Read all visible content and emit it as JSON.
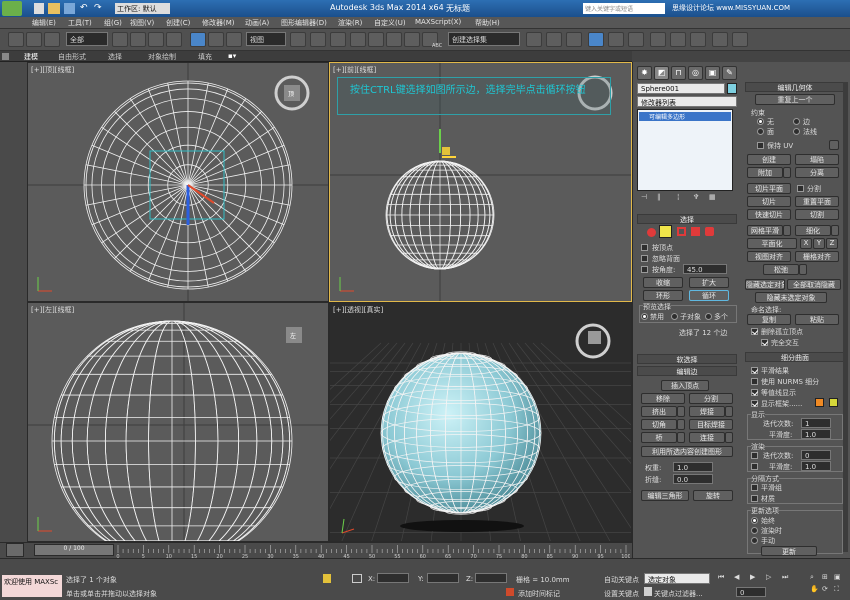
{
  "titlebar": {
    "workspace": "工作区: 默认",
    "app_title": "Autodesk 3ds Max  2014 x64",
    "doc_title": "无标题",
    "search_placeholder": "键入关键字或短语",
    "watermark": "思缘设计论坛 www.MISSYUAN.COM"
  },
  "menu": [
    "编辑(E)",
    "工具(T)",
    "组(G)",
    "视图(V)",
    "创建(C)",
    "修改器(M)",
    "动画(A)",
    "图形编辑器(D)",
    "渲染(R)",
    "自定义(U)",
    "MAXScript(X)",
    "帮助(H)"
  ],
  "toolbar": {
    "selection_filter": "全部",
    "ref_coord": "视图",
    "named_selection": "创建选择集",
    "abc_label": "ABC"
  },
  "ribbon": [
    "建模",
    "自由形式",
    "选择",
    "对象绘制",
    "填充"
  ],
  "viewports": {
    "top_left_label": "[+][顶][线框]",
    "top_right_label": "[+][前][线框]",
    "bottom_left_label": "[+][左][线框]",
    "bottom_right_label": "[+][透视][真实]",
    "cube_top": "顶",
    "cube_left": "左",
    "tip": "按住CTRL键选择如图所示边，选择完毕点击循环按钮"
  },
  "panel": {
    "object_name": "Sphere001",
    "modifier_list": "修改器列表",
    "stack_item": "可编辑多边形",
    "selection": {
      "title": "选择",
      "by_vertex": "按顶点",
      "ignore_backfacing": "忽略背面",
      "by_angle": "按角度:",
      "angle_value": "45.0",
      "shrink": "收缩",
      "grow": "扩大",
      "ring": "环形",
      "loop": "循环",
      "preview_title": "预览选择",
      "disable": "禁用",
      "subobject": "子对象",
      "multi": "多个",
      "status": "选择了 12 个边"
    },
    "soft_selection": "软选择",
    "edit_edges": {
      "title": "编辑边",
      "insert_vertex": "插入顶点",
      "remove": "移除",
      "split": "分割",
      "extrude": "挤出",
      "weld": "焊接",
      "chamfer": "切角",
      "target_weld": "目标焊接",
      "bridge": "桥",
      "connect": "连接",
      "create_shape": "利用所选内容创建图形",
      "weight_label": "权重:",
      "weight_value": "1.0",
      "crease_label": "折缝:",
      "crease_value": "0.0",
      "edit_tri": "编辑三角形",
      "turn": "旋转"
    },
    "edit_geometry": {
      "title": "编辑几何体",
      "repeat_last": "重复上一个",
      "constraints": "约束",
      "none": "无",
      "edge": "边",
      "face": "面",
      "normal": "法线",
      "preserve_uv": "保持 UV",
      "create": "创建",
      "collapse": "塌陷",
      "attach": "附加",
      "detach": "分离",
      "slice_plane": "切片平面",
      "split": "分割",
      "slice": "切片",
      "reset_plane": "重置平面",
      "quickslice": "快速切片",
      "cut": "切割",
      "meshsmooth": "网格平滑",
      "tessellate": "细化",
      "make_planar": "平面化",
      "x": "X",
      "y": "Y",
      "z": "Z",
      "view_align": "视图对齐",
      "grid_align": "栅格对齐",
      "relax": "松弛",
      "hide_selected": "隐藏选定对象",
      "unhide_all": "全部取消隐藏",
      "hide_unselected": "隐藏未选定对象",
      "named_selections": "命名选择:",
      "copy": "复制",
      "paste": "粘贴",
      "delete_isolated": "删除孤立顶点",
      "full_interactivity": "完全交互"
    },
    "subdivision": {
      "title": "细分曲面",
      "smooth_result": "平滑结果",
      "use_nurms": "使用 NURMS 细分",
      "isoline": "等值线显示",
      "show_cage": "显示框架......",
      "display": "显示",
      "iterations": "迭代次数:",
      "iter_value": "1",
      "smoothness": "平滑度:",
      "smooth_value": "1.0",
      "render": "渲染",
      "r_iter_value": "0",
      "r_smooth_value": "1.0",
      "separate_by": "分隔方式",
      "smoothing_groups": "平滑组",
      "materials": "材质",
      "update_options": "更新选项",
      "always": "始终",
      "when_rendering": "渲染时",
      "manually": "手动",
      "update": "更新"
    },
    "colors": {
      "cage1": "#f08a24",
      "cage2": "#d6d83a"
    }
  },
  "timeline": {
    "frame": "0 / 100",
    "ticks": [
      "0",
      "5",
      "10",
      "15",
      "20",
      "25",
      "30",
      "35",
      "40",
      "45",
      "50",
      "55",
      "60",
      "65",
      "70",
      "75",
      "80",
      "85",
      "90",
      "95",
      "100"
    ]
  },
  "status": {
    "welcome": "欢迎使用 MAXSc",
    "selected": "选择了 1 个对象",
    "prompt": "单击或单击并拖动以选择对象",
    "x": "X:",
    "y": "Y:",
    "z": "Z:",
    "grid": "栅格 = 10.0mm",
    "auto_key": "自动关键点",
    "set_key": "设置关键点",
    "key_filter": "关键点过滤器...",
    "selected_obj": "选定对象",
    "add_time_tag": "添加时间标记",
    "frame_value": "0"
  }
}
